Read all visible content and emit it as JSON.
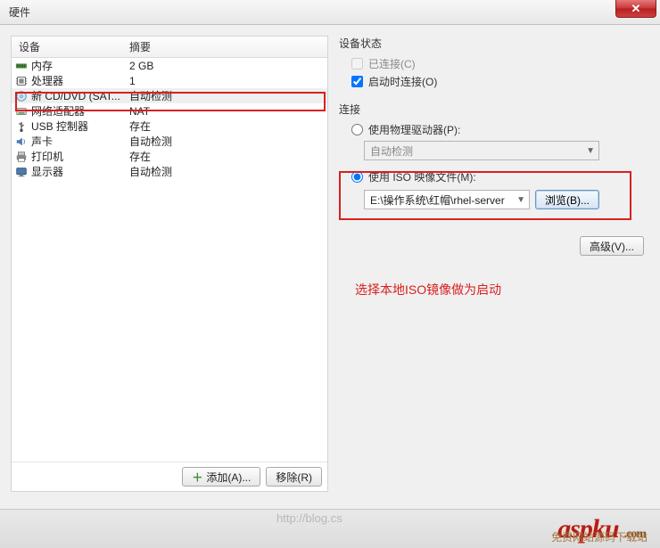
{
  "titlebar": {
    "title": "硬件"
  },
  "device_table": {
    "header_device": "设备",
    "header_summary": "摘要",
    "rows": [
      {
        "icon": "memory-icon",
        "name": "内存",
        "summary": "2 GB"
      },
      {
        "icon": "cpu-icon",
        "name": "处理器",
        "summary": "1"
      },
      {
        "icon": "disc-icon",
        "name": "新 CD/DVD (SAT...",
        "summary": "自动检测",
        "selected": true
      },
      {
        "icon": "nic-icon",
        "name": "网络适配器",
        "summary": "NAT"
      },
      {
        "icon": "usb-icon",
        "name": "USB 控制器",
        "summary": "存在"
      },
      {
        "icon": "sound-icon",
        "name": "声卡",
        "summary": "自动检测"
      },
      {
        "icon": "printer-icon",
        "name": "打印机",
        "summary": "存在"
      },
      {
        "icon": "display-icon",
        "name": "显示器",
        "summary": "自动检测"
      }
    ]
  },
  "left_buttons": {
    "add": "添加(A)...",
    "remove": "移除(R)"
  },
  "right": {
    "device_status": {
      "title": "设备状态",
      "connected": "已连接(C)",
      "connect_at_power_on": "启动时连接(O)"
    },
    "connection": {
      "title": "连接",
      "use_physical": "使用物理驱动器(P):",
      "physical_value": "自动检测",
      "use_iso": "使用 ISO 映像文件(M):",
      "iso_value": "E:\\操作系统\\红帽\\rhel-server",
      "browse": "浏览(B)..."
    },
    "advanced": "高级(V)...",
    "note": "选择本地ISO镜像做为启动"
  },
  "watermark": {
    "url": "http://blog.cs",
    "brand": "aspku",
    "tld": ".com",
    "cn": "免费网站源码下载站"
  }
}
